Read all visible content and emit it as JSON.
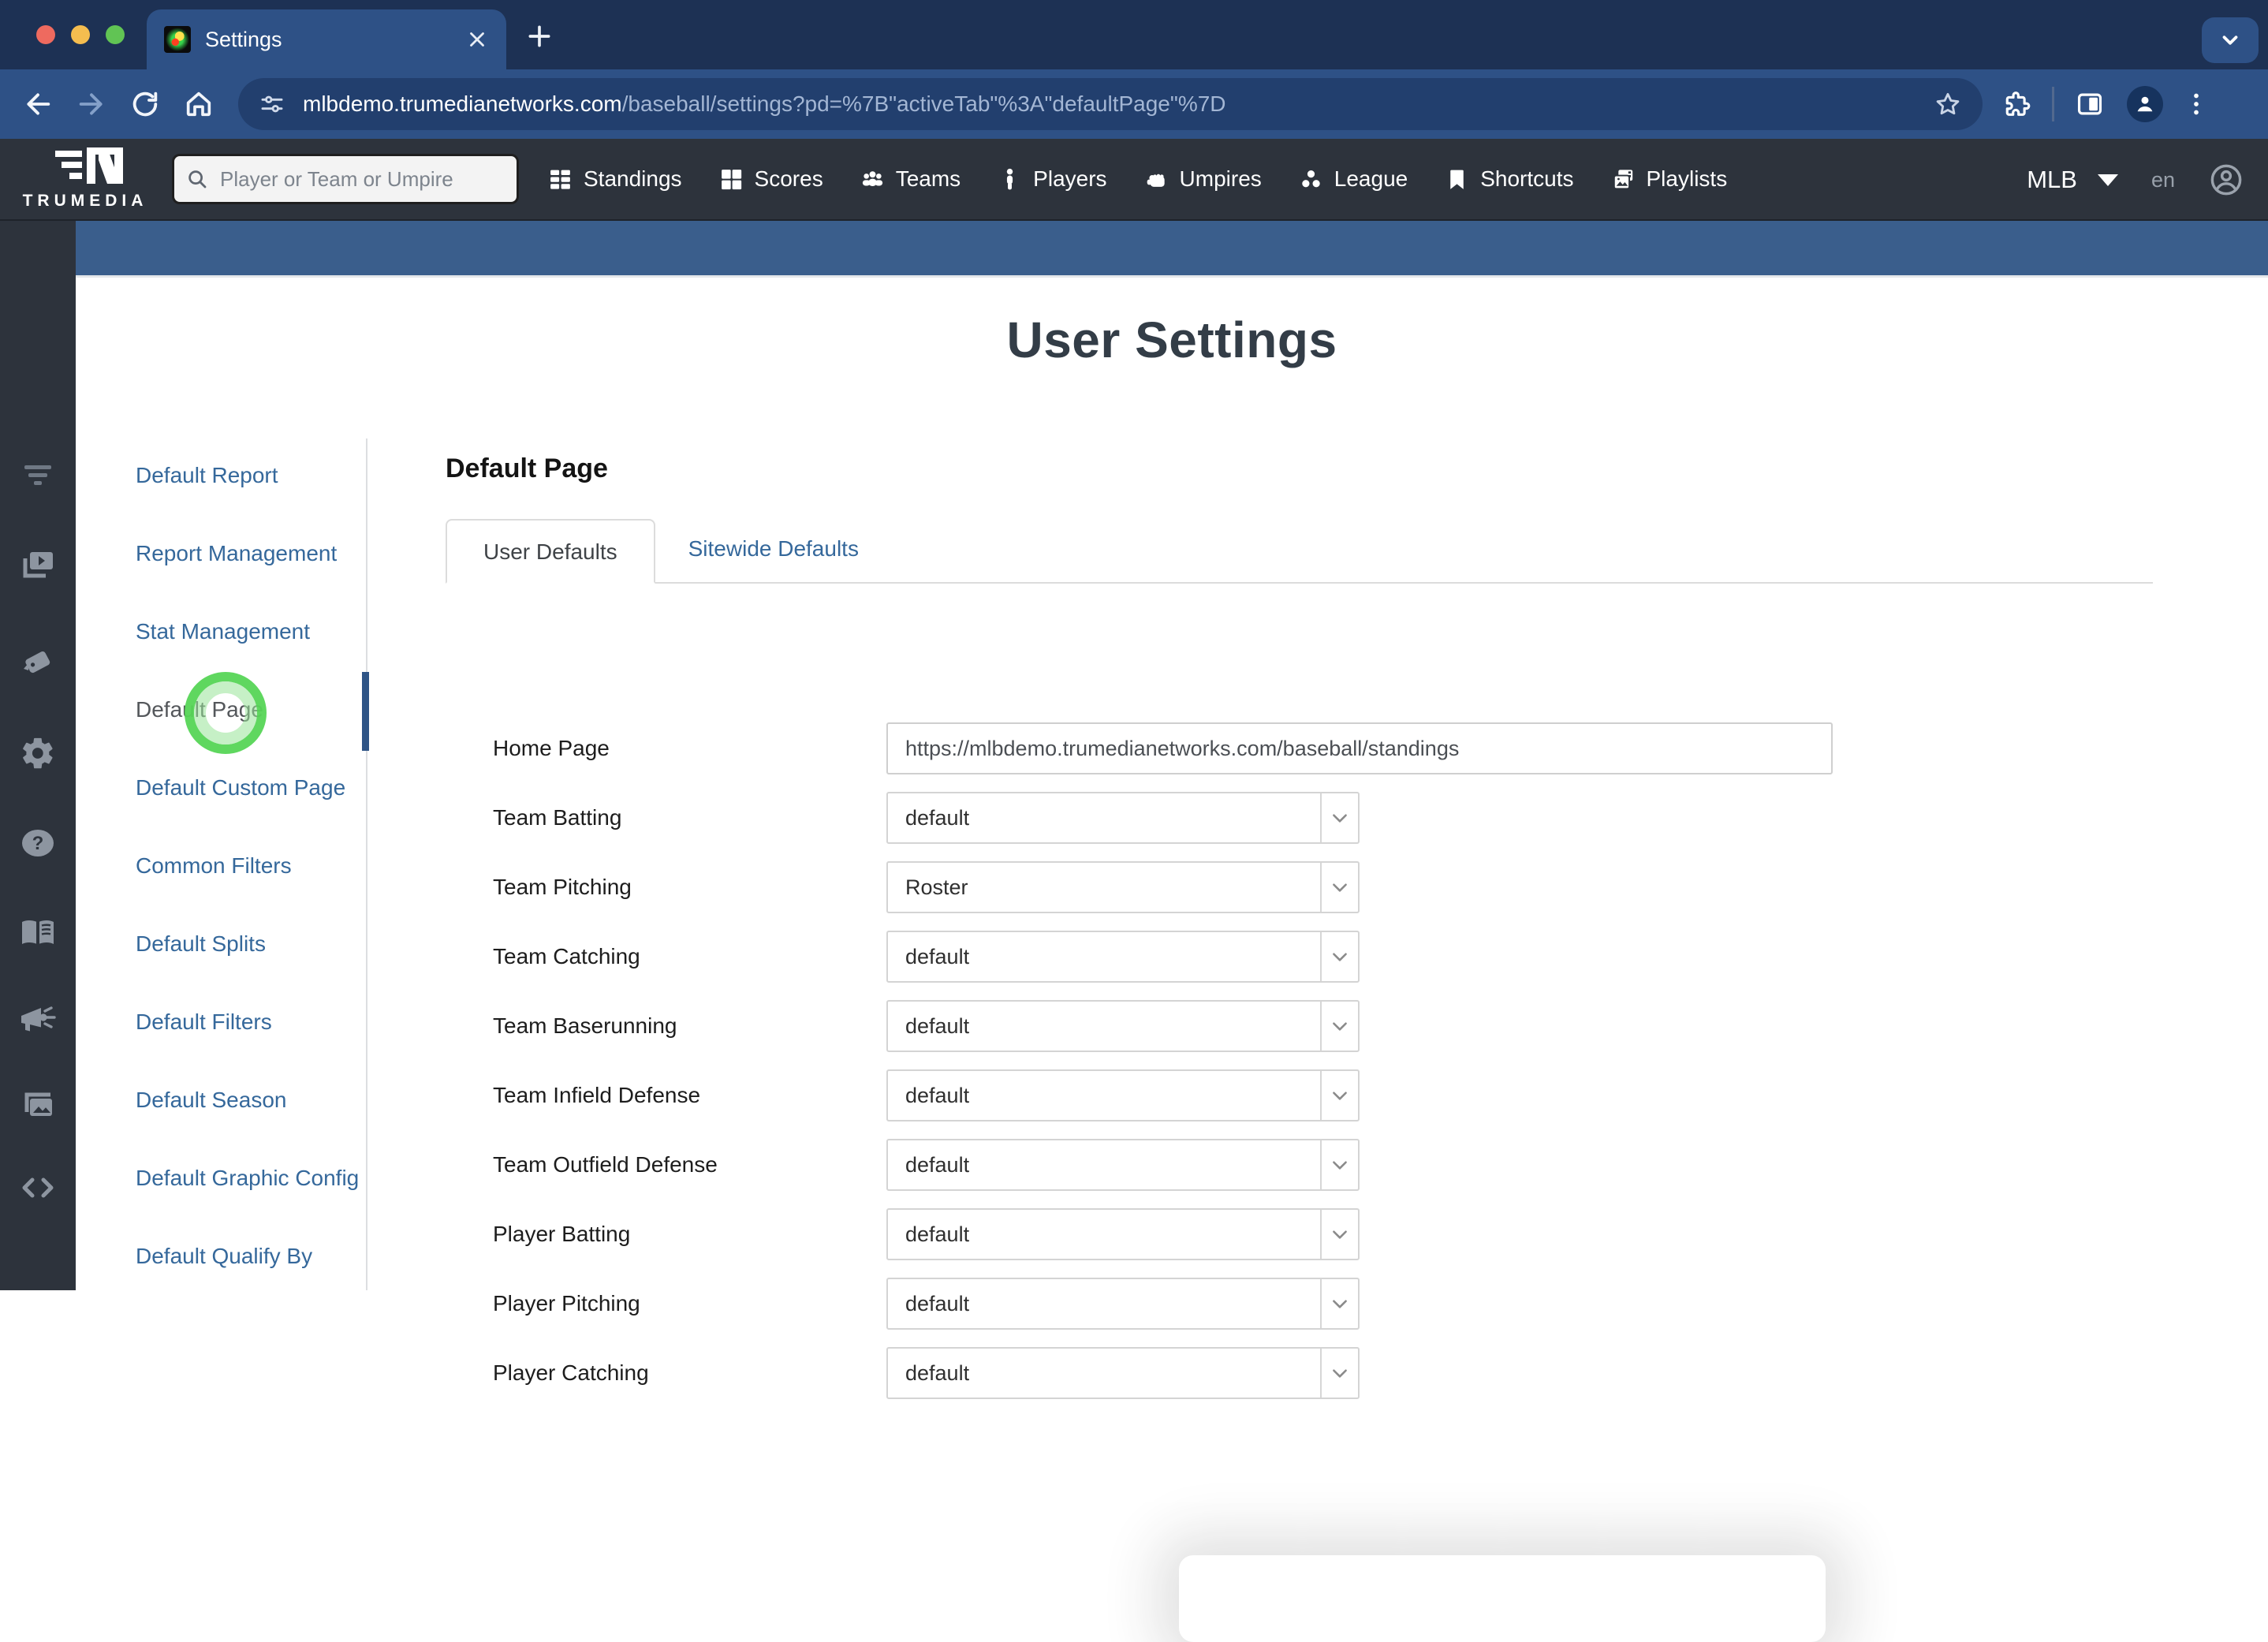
{
  "browser": {
    "tab_title": "Settings",
    "url_host": "mlbdemo.trumedianetworks.com",
    "url_rest": "/baseball/settings?pd=%7B\"activeTab\"%3A\"defaultPage\"%7D"
  },
  "topnav": {
    "brand": "TRUMEDIA",
    "search_placeholder": "Player or Team or Umpire",
    "items": [
      "Standings",
      "Scores",
      "Teams",
      "Players",
      "Umpires",
      "League",
      "Shortcuts",
      "Playlists"
    ],
    "league_label": "MLB",
    "lang_label": "en"
  },
  "rail_icons": [
    "filter-icon",
    "video-playlist-icon",
    "tag-icon",
    "gear-icon",
    "help-icon",
    "book-icon",
    "megaphone-icon",
    "gallery-icon",
    "code-icon"
  ],
  "settings_menu": {
    "items": [
      "Default Report",
      "Report Management",
      "Stat Management",
      "Default Page",
      "Default Custom Page",
      "Common Filters",
      "Default Splits",
      "Default Filters",
      "Default Season",
      "Default Graphic Config",
      "Default Qualify By"
    ],
    "active_item": "Default Page"
  },
  "page": {
    "title": "User Settings",
    "section_title": "Default Page",
    "tabs": [
      "User Defaults",
      "Sitewide Defaults"
    ],
    "active_tab": "User Defaults"
  },
  "form": {
    "rows": [
      {
        "label": "Home Page",
        "type": "text",
        "value": "https://mlbdemo.trumedianetworks.com/baseball/standings"
      },
      {
        "label": "Team Batting",
        "type": "select",
        "value": "default"
      },
      {
        "label": "Team Pitching",
        "type": "select",
        "value": "Roster"
      },
      {
        "label": "Team Catching",
        "type": "select",
        "value": "default"
      },
      {
        "label": "Team Baserunning",
        "type": "select",
        "value": "default"
      },
      {
        "label": "Team Infield Defense",
        "type": "select",
        "value": "default"
      },
      {
        "label": "Team Outfield Defense",
        "type": "select",
        "value": "default"
      },
      {
        "label": "Player Batting",
        "type": "select",
        "value": "default"
      },
      {
        "label": "Player Pitching",
        "type": "select",
        "value": "default"
      },
      {
        "label": "Player Catching",
        "type": "select",
        "value": "default"
      }
    ]
  },
  "colors": {
    "tabbar_navy": "#1d3154",
    "toolbar_blue": "#2e5186",
    "band_blue": "#3a5e8c",
    "charcoal": "#2d333c",
    "link_blue": "#35689b",
    "click_indicator_green": "#57d457"
  }
}
